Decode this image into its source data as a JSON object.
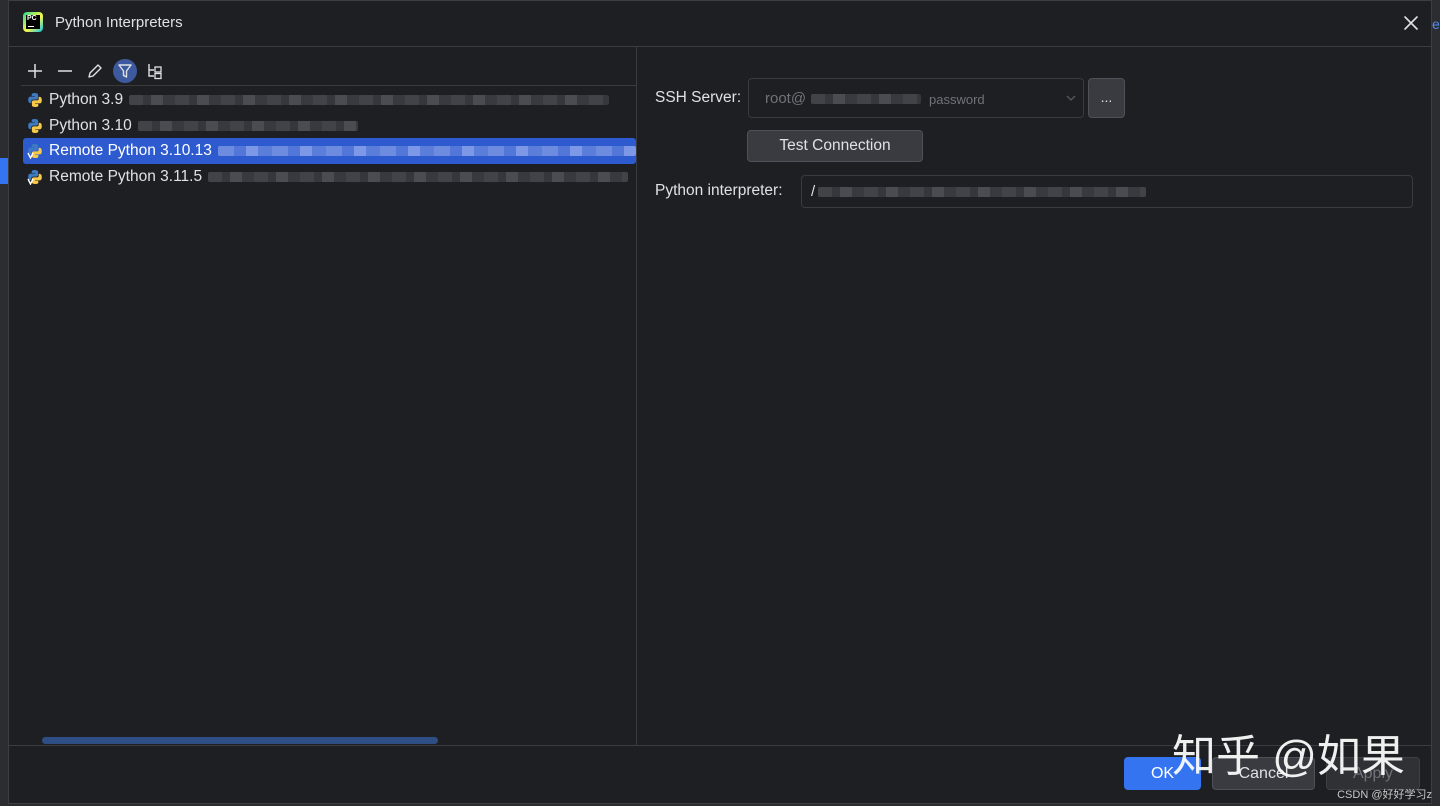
{
  "dialog": {
    "title": "Python Interpreters"
  },
  "toolbar": {
    "buttons": [
      {
        "name": "add",
        "icon": "plus-icon"
      },
      {
        "name": "remove",
        "icon": "minus-icon"
      },
      {
        "name": "edit",
        "icon": "pencil-icon"
      },
      {
        "name": "filter",
        "icon": "filter-icon",
        "active": true
      },
      {
        "name": "show-paths",
        "icon": "tree-icon"
      }
    ]
  },
  "interpreters": [
    {
      "label": "Python 3.9",
      "selected": false,
      "remote": false
    },
    {
      "label": "Python 3.10",
      "selected": false,
      "remote": false
    },
    {
      "label": "Remote Python 3.10.13",
      "selected": true,
      "remote": true
    },
    {
      "label": "Remote Python 3.11.5",
      "selected": false,
      "remote": true
    }
  ],
  "details": {
    "ssh_label": "SSH Server:",
    "ssh_value": "root@",
    "ssh_auth": "password",
    "ellipsis_label": "...",
    "test_connection_label": "Test Connection",
    "interpreter_label": "Python interpreter:",
    "interpreter_value": "/"
  },
  "footer": {
    "ok_label": "OK",
    "cancel_label": "Cancel",
    "apply_label": "Apply"
  },
  "watermark": {
    "text": "知乎 @如果",
    "csdn": "CSDN @好好学习z"
  },
  "edge": {
    "right_char": "e"
  },
  "colors": {
    "accent": "#3574f0",
    "background": "#1e1f22",
    "selection": "#2e5ad0"
  }
}
